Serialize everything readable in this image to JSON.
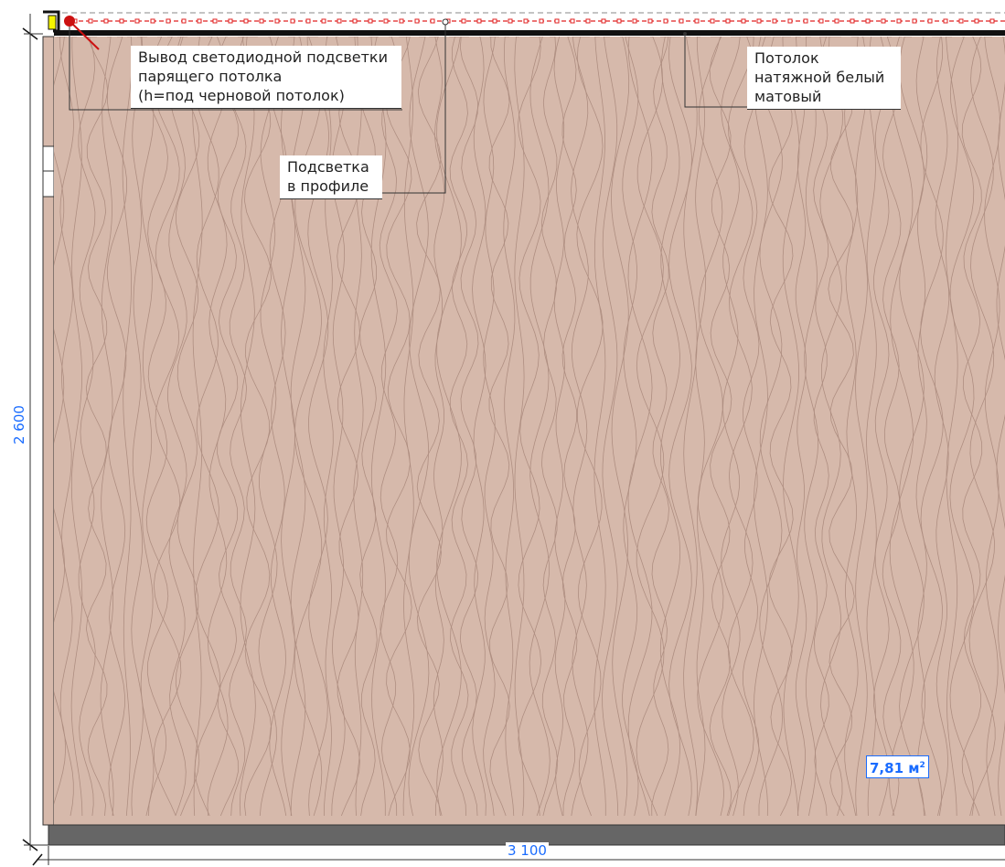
{
  "annotations": {
    "led_outlet": "Вывод светодиодной подсветки\nпарящего потолка\n(h=под черновой потолок)",
    "profile_light": "Подсветка\nв профиле",
    "ceiling": "Потолок\nнатяжной белый\nматовый"
  },
  "dimensions": {
    "height": "2 600",
    "width": "3 100"
  },
  "area": {
    "value": "7,81 м",
    "unit_sup": "2"
  },
  "colors": {
    "wall_fill": "#d6b9ab",
    "wood_grain": "#a8877a",
    "led_strip": "#e02020",
    "floor_band": "#666666",
    "dimension": "#1a6cff",
    "outlet": "#cc1111"
  }
}
